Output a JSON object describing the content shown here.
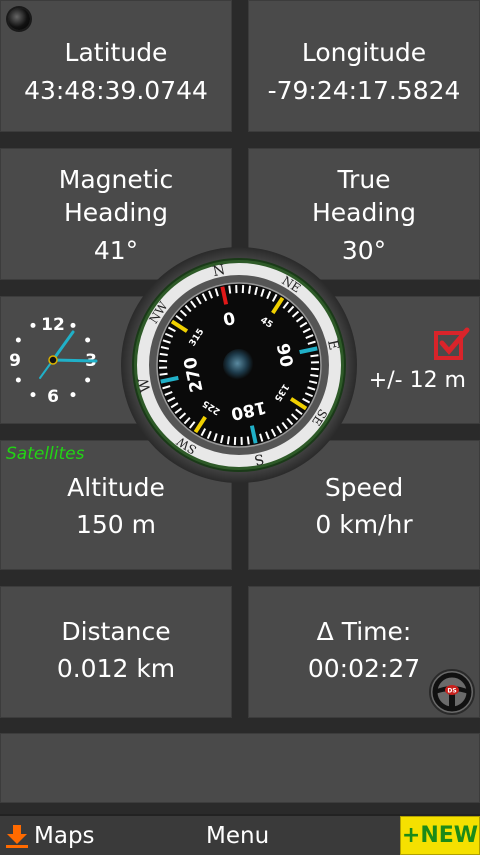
{
  "latitude": {
    "label": "Latitude",
    "value": "43:48:39.0744"
  },
  "longitude": {
    "label": "Longitude",
    "value": "-79:24:17.5824"
  },
  "magnetic_heading": {
    "label_line1": "Magnetic",
    "label_line2": "Heading",
    "value": "41°"
  },
  "true_heading": {
    "label_line1": "True",
    "label_line2": "Heading",
    "value": "30°"
  },
  "accuracy": {
    "value": "+/- 12 m",
    "check_color": "#d9242a"
  },
  "satellites": {
    "label": "Satellites",
    "color": "#22d414"
  },
  "altitude": {
    "label": "Altitude",
    "value": "150 m"
  },
  "speed": {
    "label": "Speed",
    "value": "0 km/hr"
  },
  "distance": {
    "label": "Distance",
    "value": "0.012 km"
  },
  "delta_time": {
    "label": "Δ Time:",
    "value": "00:02:27"
  },
  "compass": {
    "cardinals": [
      "N",
      "NE",
      "E",
      "SE",
      "S",
      "SW",
      "W",
      "NW"
    ],
    "degree_labels": [
      "0",
      "45",
      "90",
      "135",
      "180",
      "225",
      "270",
      "315"
    ]
  },
  "clock": {
    "numerals": [
      "12",
      "3",
      "6",
      "9"
    ]
  },
  "steering_badge": "DS",
  "bottom_bar": {
    "maps_label": "Maps",
    "menu_label": "Menu",
    "new_label": "+NEW"
  },
  "colors": {
    "panel": "#4a4a4a",
    "background": "#2a2a2a",
    "accent_cyan": "#20b0c8",
    "new_button": "#f5e000"
  }
}
